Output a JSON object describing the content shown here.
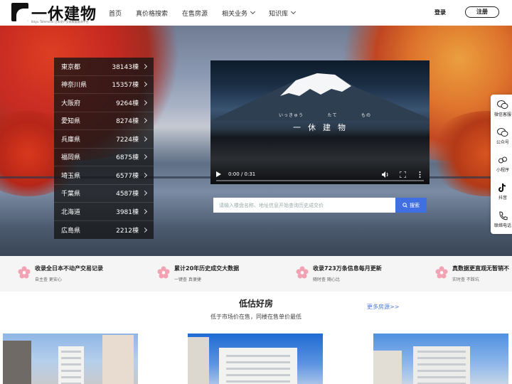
{
  "header": {
    "logo_text": "一休建物",
    "logo_sub": "Ikkyu Tatemono 日本房产交易数据查询平台",
    "nav": [
      {
        "label": "首页",
        "dropdown": false
      },
      {
        "label": "真价格搜索",
        "dropdown": false
      },
      {
        "label": "在售房源",
        "dropdown": false
      },
      {
        "label": "相关业务",
        "dropdown": true
      },
      {
        "label": "知识库",
        "dropdown": true
      }
    ],
    "login": "登录",
    "register": "注册"
  },
  "cities": [
    {
      "name": "東京都",
      "count": "38143棟"
    },
    {
      "name": "神奈川県",
      "count": "15357棟"
    },
    {
      "name": "大阪府",
      "count": "9264棟"
    },
    {
      "name": "愛知県",
      "count": "8274棟"
    },
    {
      "name": "兵庫県",
      "count": "7224棟"
    },
    {
      "name": "福岡県",
      "count": "6875棟"
    },
    {
      "name": "埼玉県",
      "count": "6577棟"
    },
    {
      "name": "千葉県",
      "count": "4587棟"
    },
    {
      "name": "北海道",
      "count": "3981棟"
    },
    {
      "name": "広島県",
      "count": "2212棟"
    }
  ],
  "video": {
    "kana": [
      "いっきゅう",
      "たて",
      "もの"
    ],
    "title": "一休建物",
    "time": "0:00 / 0:31"
  },
  "search": {
    "placeholder": "请输入楼盘名称、地址信息开始查询历史成交价",
    "button": "搜索"
  },
  "side": [
    {
      "label": "微信客服",
      "icon": "wechat-icon"
    },
    {
      "label": "公众号",
      "icon": "wechat-official-icon"
    },
    {
      "label": "小程序",
      "icon": "mini-program-icon"
    },
    {
      "label": "抖音",
      "icon": "tiktok-icon"
    },
    {
      "label": "联络电话",
      "icon": "phone-icon"
    }
  ],
  "features": [
    {
      "title": "收录全日本不动产交易记录",
      "sub": "自主查 更安心"
    },
    {
      "title": "累计20年历史成交大数据",
      "sub": "一键查 真便捷"
    },
    {
      "title": "收录723万条信息每月更新",
      "sub": "随时查 随心比"
    },
    {
      "title": "真数据更直观无暂销不",
      "sub": "实时查 不踩坑"
    }
  ],
  "section": {
    "title": "低估好房",
    "subtitle": "低于市场价在售，同楼在售单价最低",
    "more": "更多房源>>"
  },
  "colors": {
    "accent": "#3f6fe0",
    "feature_icon": "#f2a3b3",
    "link": "#4a7ae0"
  }
}
